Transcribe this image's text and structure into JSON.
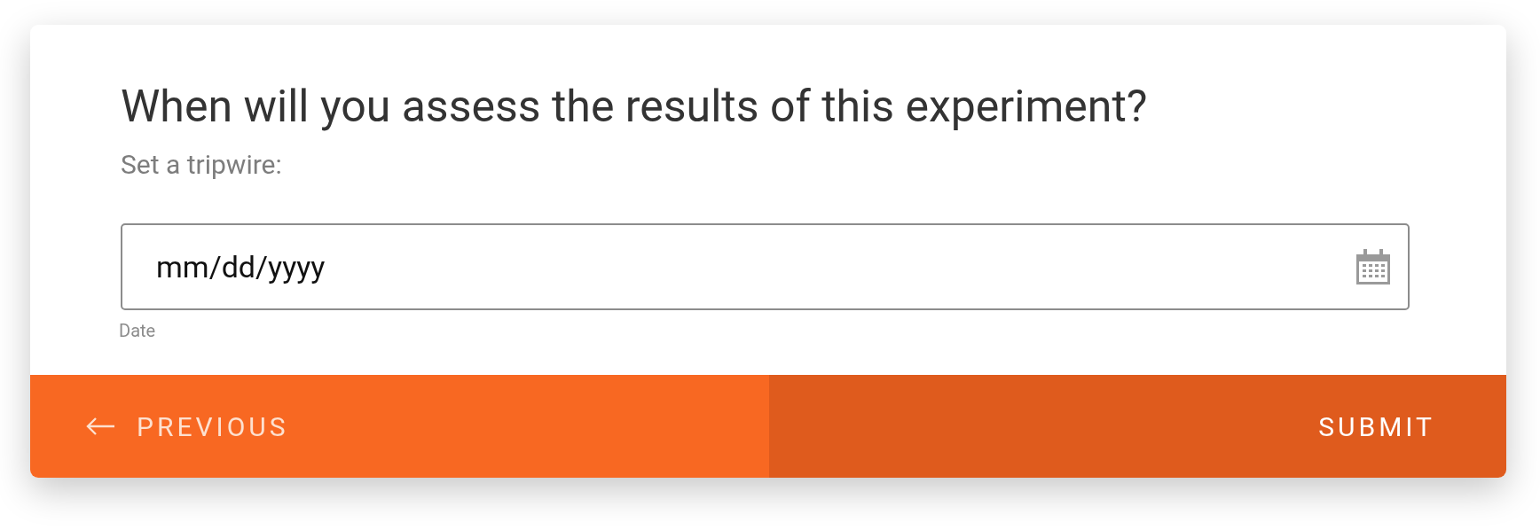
{
  "question": "When will you assess the results of this experiment?",
  "subtitle": "Set a tripwire:",
  "date_field": {
    "placeholder": "mm/dd/yyyy",
    "helper": "Date"
  },
  "buttons": [
    {
      "label": "PREVIOUS",
      "kind": "back"
    },
    {
      "label": "SUBMIT",
      "kind": "submit"
    }
  ]
}
